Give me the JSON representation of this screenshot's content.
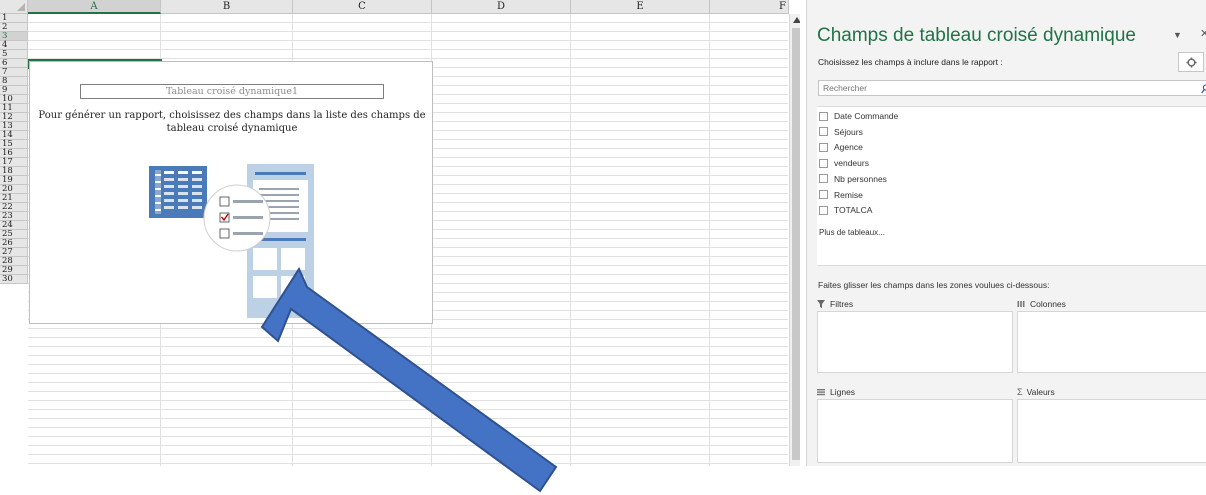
{
  "sheet": {
    "columns": [
      "A",
      "B",
      "C",
      "D",
      "E",
      "F"
    ],
    "selected_column": "A",
    "rows": [
      "1",
      "2",
      "3",
      "4",
      "5",
      "6",
      "7",
      "8",
      "9",
      "10",
      "11",
      "12",
      "13",
      "14",
      "15",
      "16",
      "17",
      "18",
      "19",
      "20",
      "21",
      "22",
      "23",
      "24",
      "25",
      "26",
      "27",
      "28",
      "29",
      "30"
    ],
    "selected_row": "3"
  },
  "pivot": {
    "name": "Tableau croisé dynamique1",
    "instruction": "Pour générer un rapport, choisissez des champs dans la liste des champs de tableau croisé dynamique"
  },
  "pane": {
    "title": "Champs de tableau croisé dynamique",
    "subtitle": "Choisissez les champs à inclure dans le rapport :",
    "search_placeholder": "Rechercher",
    "fields": [
      "Date Commande",
      "Séjours",
      "Agence",
      "vendeurs",
      "Nb personnes",
      "Remise",
      "TOTALCA"
    ],
    "more_tables": "Plus de tableaux...",
    "drag_instruction": "Faites glisser les champs dans les zones voulues ci-dessous:",
    "zones": {
      "filters": "Filtres",
      "columns": "Colonnes",
      "rows": "Lignes",
      "values": "Valeurs"
    }
  },
  "colors": {
    "accent": "#217346",
    "arrow_fill": "#4472c4",
    "arrow_stroke": "#2f528f",
    "illustration_blue": "#4a7ab7",
    "illustration_light": "#bcd0e6"
  }
}
